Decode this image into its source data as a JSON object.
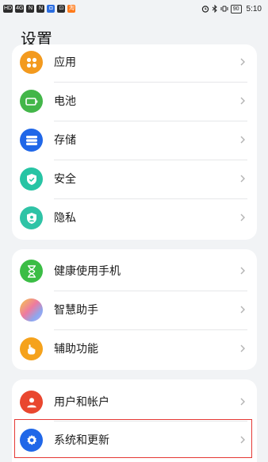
{
  "status_bar": {
    "left_chips": [
      "HD",
      "4G",
      "N",
      "N",
      "◘",
      "⊡",
      "淘"
    ],
    "battery": "90",
    "time": "5:10"
  },
  "title": "设置",
  "groups": [
    {
      "items": [
        {
          "label": "应用",
          "icon": "apps-icon",
          "color": "#f39a1e"
        },
        {
          "label": "电池",
          "icon": "battery-icon",
          "color": "#43b649"
        },
        {
          "label": "存储",
          "icon": "storage-icon",
          "color": "#2067e8"
        },
        {
          "label": "安全",
          "icon": "shield-icon",
          "color": "#27c4a4"
        },
        {
          "label": "隐私",
          "icon": "privacy-icon",
          "color": "#2fc3a6"
        }
      ]
    },
    {
      "items": [
        {
          "label": "健康使用手机",
          "icon": "hourglass-icon",
          "color": "#3bbd45"
        },
        {
          "label": "智慧助手",
          "icon": "assistant-icon",
          "color": "#b78de6"
        },
        {
          "label": "辅助功能",
          "icon": "hand-icon",
          "color": "#f5a21c"
        }
      ]
    },
    {
      "items": [
        {
          "label": "用户和帐户",
          "icon": "user-icon",
          "color": "#e9472f"
        },
        {
          "label": "系统和更新",
          "icon": "gear-icon",
          "color": "#2067e8"
        }
      ]
    }
  ]
}
